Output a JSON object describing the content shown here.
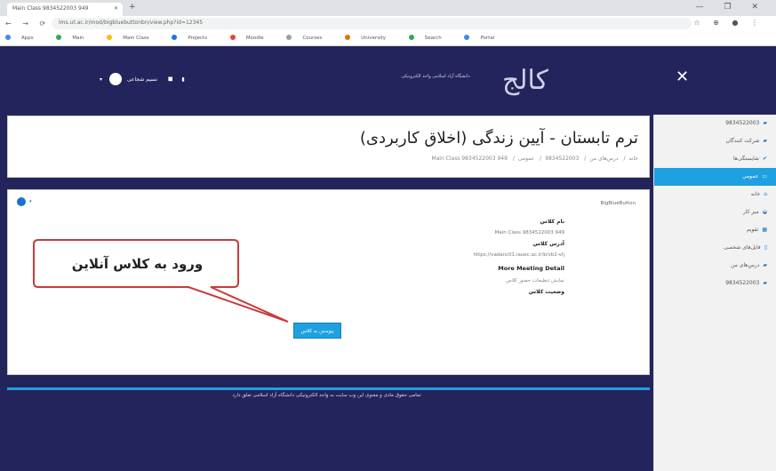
{
  "browser": {
    "tab_title": "Main Class 9834522003 949",
    "new_tab": "+",
    "url": "lms.ut.ac.ir/mod/bigbluebuttonbn/view.php?id=12345",
    "bookmarks": [
      "Apps",
      "Main",
      "Main Class",
      "Projects",
      "Moodle",
      "Courses",
      "University",
      "Search",
      "Portal"
    ],
    "window_controls": "— ❐ ✕"
  },
  "header": {
    "university_name": "دانشگاه آزاد اسلامی واحد الکترونیکی",
    "logo_text": "کالج",
    "user_name": "نسیم شجاعی",
    "close_label": "✕"
  },
  "sidebar": {
    "items": [
      {
        "label": "9834522003",
        "icon": "graduation-cap-icon",
        "active": false
      },
      {
        "label": "شرکت کنندگان",
        "icon": "users-icon",
        "active": false
      },
      {
        "label": "شایستگی‌ها",
        "icon": "check-icon",
        "active": false
      },
      {
        "label": "عمومی",
        "icon": "folder-icon",
        "active": true
      },
      {
        "label": "خانه",
        "icon": "home-icon",
        "active": false
      },
      {
        "label": "میز کار",
        "icon": "dashboard-icon",
        "active": false
      },
      {
        "label": "تقویم",
        "icon": "calendar-icon",
        "active": false
      },
      {
        "label": "فایل‌های شخصی",
        "icon": "file-icon",
        "active": false
      },
      {
        "label": "درس‌های من",
        "icon": "graduation-cap-icon",
        "active": false
      },
      {
        "label": "9834522003",
        "icon": "graduation-cap-icon",
        "active": false
      }
    ]
  },
  "course": {
    "title": "ترم تابستان - آیین زندگی (اخلاق کاربردی)",
    "breadcrumbs": [
      "خانه",
      "درس‌های من",
      "9834522003",
      "عمومی",
      "Main Class 9834522003 949"
    ]
  },
  "activity": {
    "module_label": "BigBlueButton",
    "class_name_label": "نام کلاس",
    "class_name_value": "Main Class 9834522003 949",
    "class_address_label": "آدرس کلاس",
    "class_address_value": "https://vadanc01.iauec.ac.ir/b/vb2-vlj",
    "meeting_detail": "More Meeting Detail",
    "guide_text": "نمایش تنظیمات حضور کلاس",
    "class_status": "وضعیت کلاس",
    "join_button": "پیوستن به کلاس"
  },
  "callout": {
    "text": "ورود به کلاس آنلاین"
  },
  "footer": {
    "copyright": "تمامی حقوق مادی و معنوی این وب سایت به واحد الکترونیکی دانشگاه آزاد اسلامی تعلق دارد"
  }
}
